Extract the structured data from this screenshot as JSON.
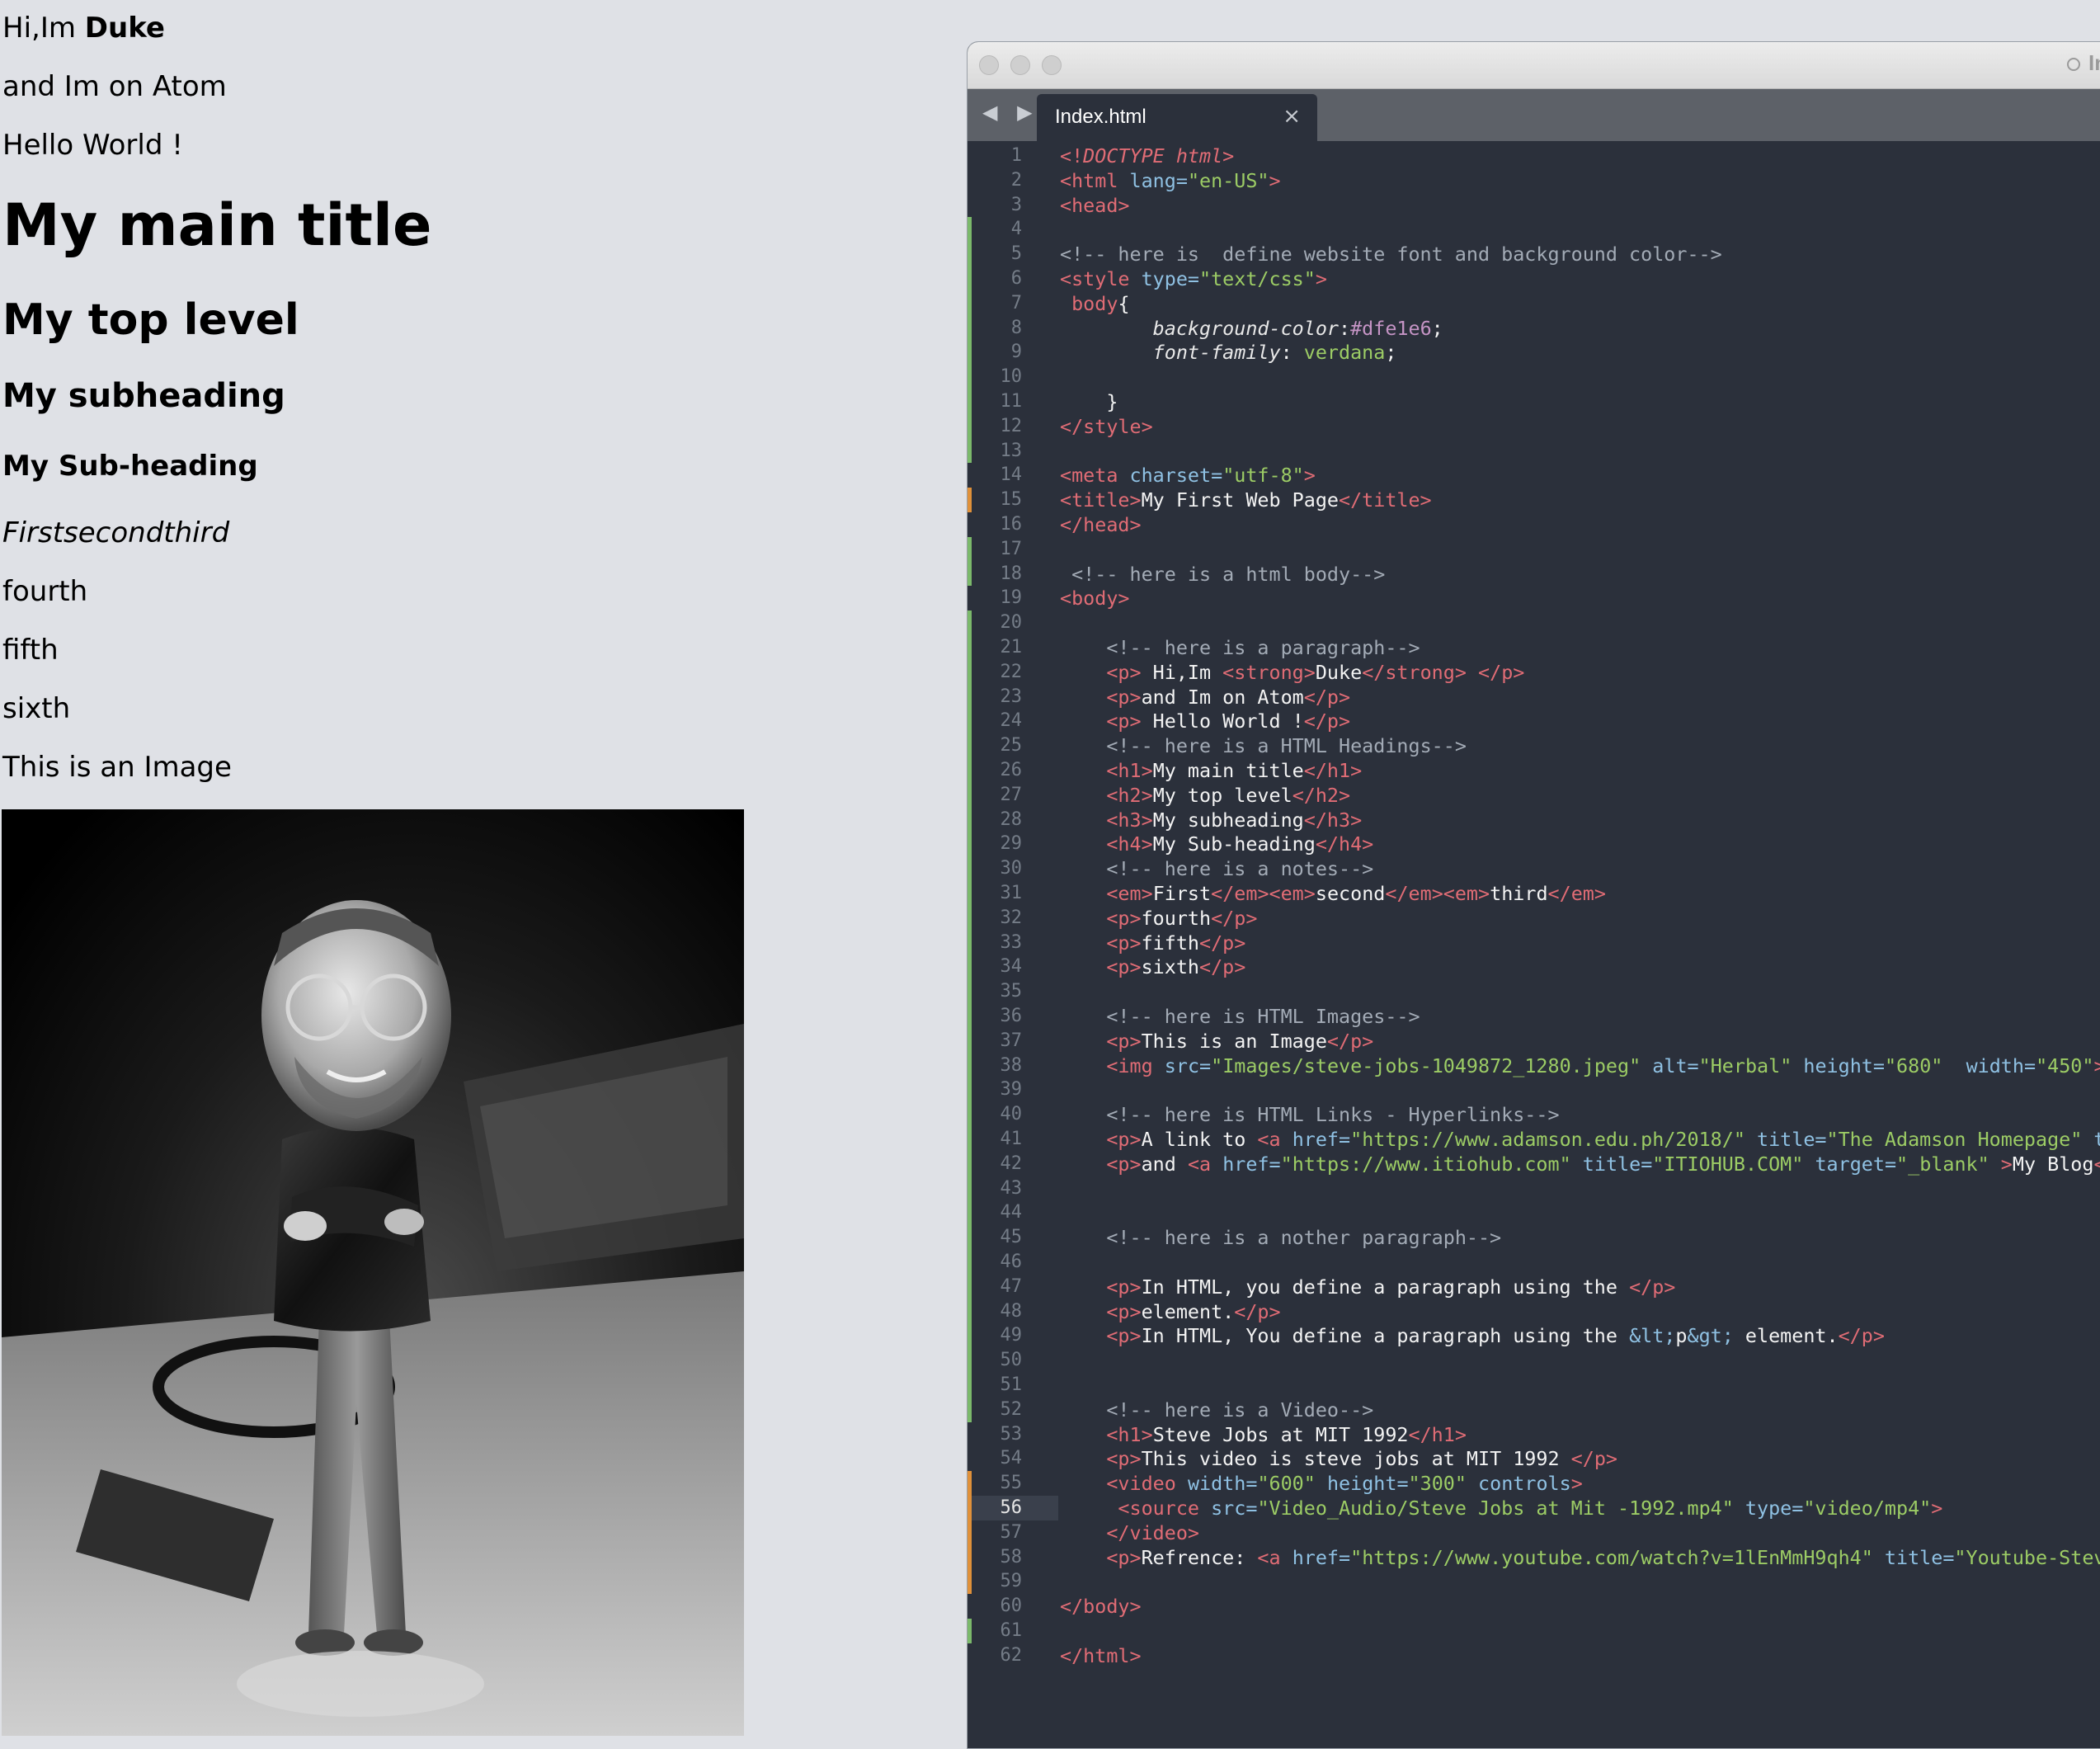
{
  "rendered_page": {
    "p1_text": "Hi,Im ",
    "p1_strong": "Duke",
    "p2": "and Im on Atom",
    "p3": "Hello World !",
    "h1": "My main title",
    "h2": "My top level",
    "h3": "My subheading",
    "h4": "My Sub-heading",
    "em_line": "Firstsecondthird",
    "p_fourth": "fourth",
    "p_fifth": "fifth",
    "p_sixth": "sixth",
    "p_image": "This is an Image"
  },
  "editor": {
    "window_title": "Ind",
    "tab_label": "Index.html",
    "tab_close": "×",
    "nav_arrows": "◀ ▶",
    "current_line": 56,
    "lines": [
      {
        "n": "1",
        "html": "<span class='tg'>&lt;!</span><span class='kw'>DOCTYPE html</span><span class='tg'>&gt;</span>"
      },
      {
        "n": "2",
        "html": "<span class='tg'>&lt;html</span> <span class='at'>lang=</span><span class='st'>\"en-US\"</span><span class='tg'>&gt;</span>"
      },
      {
        "n": "3",
        "html": "<span class='tg'>&lt;head&gt;</span>"
      },
      {
        "n": "4",
        "html": ""
      },
      {
        "n": "5",
        "html": "<span class='cm'>&lt;!-- here is  define website font and background color--&gt;</span>"
      },
      {
        "n": "6",
        "html": "<span class='tg'>&lt;style</span> <span class='at'>type=</span><span class='st'>\"text/css\"</span><span class='tg'>&gt;</span>"
      },
      {
        "n": "7",
        "html": " <span class='tg'>body</span><span class='tx'>{</span>"
      },
      {
        "n": "8",
        "html": "        <span class='pr'>background-color</span><span class='tx'>:</span><span class='hx'>#dfe1e6</span><span class='tx'>;</span>"
      },
      {
        "n": "9",
        "html": "        <span class='pr'>font-family</span><span class='tx'>: </span><span class='vl'>verdana</span><span class='tx'>;</span>"
      },
      {
        "n": "10",
        "html": ""
      },
      {
        "n": "11",
        "html": "    <span class='tx'>}</span>"
      },
      {
        "n": "12",
        "html": "<span class='tg'>&lt;/style&gt;</span>"
      },
      {
        "n": "13",
        "html": ""
      },
      {
        "n": "14",
        "html": "<span class='tg'>&lt;meta</span> <span class='at'>charset=</span><span class='st'>\"utf-8\"</span><span class='tg'>&gt;</span>"
      },
      {
        "n": "15",
        "html": "<span class='tg'>&lt;title&gt;</span><span class='tx'>My First Web Page</span><span class='tg'>&lt;/title&gt;</span>"
      },
      {
        "n": "16",
        "html": "<span class='tg'>&lt;/head&gt;</span>"
      },
      {
        "n": "17",
        "html": ""
      },
      {
        "n": "18",
        "html": " <span class='cm'>&lt;!-- here is a html body--&gt;</span>"
      },
      {
        "n": "19",
        "html": "<span class='tg'>&lt;body&gt;</span>"
      },
      {
        "n": "20",
        "html": ""
      },
      {
        "n": "21",
        "html": "    <span class='cm'>&lt;!-- here is a paragraph--&gt;</span>"
      },
      {
        "n": "22",
        "html": "    <span class='tg'>&lt;p&gt;</span><span class='tx'> Hi,Im </span><span class='tg'>&lt;strong&gt;</span><span class='tx'>Duke</span><span class='tg'>&lt;/strong&gt;</span><span class='tx'> </span><span class='tg'>&lt;/p&gt;</span>"
      },
      {
        "n": "23",
        "html": "    <span class='tg'>&lt;p&gt;</span><span class='tx'>and Im on Atom</span><span class='tg'>&lt;/p&gt;</span>"
      },
      {
        "n": "24",
        "html": "    <span class='tg'>&lt;p&gt;</span><span class='tx'> Hello World !</span><span class='tg'>&lt;/p&gt;</span>"
      },
      {
        "n": "25",
        "html": "    <span class='cm'>&lt;!-- here is a HTML Headings--&gt;</span>"
      },
      {
        "n": "26",
        "html": "    <span class='tg'>&lt;h1&gt;</span><span class='tx'>My main title</span><span class='tg'>&lt;/h1&gt;</span>"
      },
      {
        "n": "27",
        "html": "    <span class='tg'>&lt;h2&gt;</span><span class='tx'>My top level</span><span class='tg'>&lt;/h2&gt;</span>"
      },
      {
        "n": "28",
        "html": "    <span class='tg'>&lt;h3&gt;</span><span class='tx'>My subheading</span><span class='tg'>&lt;/h3&gt;</span>"
      },
      {
        "n": "29",
        "html": "    <span class='tg'>&lt;h4&gt;</span><span class='tx'>My Sub-heading</span><span class='tg'>&lt;/h4&gt;</span>"
      },
      {
        "n": "30",
        "html": "    <span class='cm'>&lt;!-- here is a notes--&gt;</span>"
      },
      {
        "n": "31",
        "html": "    <span class='tg'>&lt;em&gt;</span><span class='tx'>First</span><span class='tg'>&lt;/em&gt;&lt;em&gt;</span><span class='tx'>second</span><span class='tg'>&lt;/em&gt;&lt;em&gt;</span><span class='tx'>third</span><span class='tg'>&lt;/em&gt;</span>"
      },
      {
        "n": "32",
        "html": "    <span class='tg'>&lt;p&gt;</span><span class='tx'>fourth</span><span class='tg'>&lt;/p&gt;</span>"
      },
      {
        "n": "33",
        "html": "    <span class='tg'>&lt;p&gt;</span><span class='tx'>fifth</span><span class='tg'>&lt;/p&gt;</span>"
      },
      {
        "n": "34",
        "html": "    <span class='tg'>&lt;p&gt;</span><span class='tx'>sixth</span><span class='tg'>&lt;/p&gt;</span>"
      },
      {
        "n": "35",
        "html": ""
      },
      {
        "n": "36",
        "html": "    <span class='cm'>&lt;!-- here is HTML Images--&gt;</span>"
      },
      {
        "n": "37",
        "html": "    <span class='tg'>&lt;p&gt;</span><span class='tx'>This is an Image</span><span class='tg'>&lt;/p&gt;</span>"
      },
      {
        "n": "38",
        "html": "    <span class='tg'>&lt;img</span> <span class='at'>src=</span><span class='st'>\"Images/steve-jobs-1049872_1280.jpeg\"</span> <span class='at'>alt=</span><span class='st'>\"Herbal\"</span> <span class='at'>height=</span><span class='st'>\"680\"</span>  <span class='at'>width=</span><span class='st'>\"450\"</span><span class='tg'>&gt;</span>"
      },
      {
        "n": "39",
        "html": ""
      },
      {
        "n": "40",
        "html": "    <span class='cm'>&lt;!-- here is HTML Links - Hyperlinks--&gt;</span>"
      },
      {
        "n": "41",
        "html": "    <span class='tg'>&lt;p&gt;</span><span class='tx'>A link to </span><span class='tg'>&lt;a</span> <span class='at'>href=</span><span class='st'>\"https://www.adamson.edu.ph/2018/\"</span> <span class='at'>title=</span><span class='st'>\"The Adamson Homepage\"</span> <span class='at'>t</span>"
      },
      {
        "n": "42",
        "html": "    <span class='tg'>&lt;p&gt;</span><span class='tx'>and </span><span class='tg'>&lt;a</span> <span class='at'>href=</span><span class='st'>\"https://www.itiohub.com\"</span> <span class='at'>title=</span><span class='st'>\"ITIOHUB.COM\"</span> <span class='at'>target=</span><span class='st'>\"_blank\"</span> <span class='tg'>&gt;</span><span class='tx'>My Blog</span><span class='tg'>&lt;</span>"
      },
      {
        "n": "43",
        "html": ""
      },
      {
        "n": "44",
        "html": ""
      },
      {
        "n": "45",
        "html": "    <span class='cm'>&lt;!-- here is a nother paragraph--&gt;</span>"
      },
      {
        "n": "46",
        "html": ""
      },
      {
        "n": "47",
        "html": "    <span class='tg'>&lt;p&gt;</span><span class='tx'>In HTML, you define a paragraph using the </span><span class='tg'>&lt;/p&gt;</span>"
      },
      {
        "n": "48",
        "html": "    <span class='tg'>&lt;p&gt;</span><span class='tx'>element.</span><span class='tg'>&lt;/p&gt;</span>"
      },
      {
        "n": "49",
        "html": "    <span class='tg'>&lt;p&gt;</span><span class='tx'>In HTML, You define a paragraph using the </span><span class='at'>&amp;lt;</span><span class='tx'>p</span><span class='at'>&amp;gt;</span><span class='tx'> element.</span><span class='tg'>&lt;/p&gt;</span>"
      },
      {
        "n": "50",
        "html": ""
      },
      {
        "n": "51",
        "html": ""
      },
      {
        "n": "52",
        "html": "    <span class='cm'>&lt;!-- here is a Video--&gt;</span>"
      },
      {
        "n": "53",
        "html": "    <span class='tg'>&lt;h1&gt;</span><span class='tx'>Steve Jobs at MIT 1992</span><span class='tg'>&lt;/h1&gt;</span>"
      },
      {
        "n": "54",
        "html": "    <span class='tg'>&lt;p&gt;</span><span class='tx'>This video is steve jobs at MIT 1992 </span><span class='tg'>&lt;/p&gt;</span>"
      },
      {
        "n": "55",
        "html": "    <span class='tg'>&lt;video</span> <span class='at'>width=</span><span class='st'>\"600\"</span> <span class='at'>height=</span><span class='st'>\"300\"</span> <span class='at'>controls</span><span class='tg'>&gt;</span>"
      },
      {
        "n": "56",
        "html": "     <span class='tg'>&lt;source</span> <span class='at'>src=</span><span class='st'>\"Video_Audio/Steve Jobs at Mit -1992.mp4\"</span> <span class='at'>type=</span><span class='st'>\"video/mp4\"</span><span class='tg'>&gt;</span>"
      },
      {
        "n": "57",
        "html": "    <span class='tg'>&lt;/video&gt;</span>"
      },
      {
        "n": "58",
        "html": "    <span class='tg'>&lt;p&gt;</span><span class='tx'>Refrence: </span><span class='tg'>&lt;a</span> <span class='at'>href=</span><span class='st'>\"https://www.youtube.com/watch?v=1lEnMmH9qh4\"</span> <span class='at'>title=</span><span class='st'>\"Youtube-Stev</span>"
      },
      {
        "n": "59",
        "html": ""
      },
      {
        "n": "60",
        "html": "<span class='tg'>&lt;/body&gt;</span>"
      },
      {
        "n": "61",
        "html": ""
      },
      {
        "n": "62",
        "html": "<span class='tg'>&lt;/html&gt;</span>"
      }
    ],
    "git_markers": [
      {
        "from": 4,
        "to": 13,
        "color": "#7bb96b"
      },
      {
        "from": 15,
        "to": 15,
        "color": "#e0913a"
      },
      {
        "from": 17,
        "to": 18,
        "color": "#7bb96b"
      },
      {
        "from": 20,
        "to": 52,
        "color": "#7bb96b"
      },
      {
        "from": 55,
        "to": 59,
        "color": "#e0913a"
      },
      {
        "from": 61,
        "to": 61,
        "color": "#7bb96b"
      }
    ],
    "colors": {
      "editor_bg": "#2b303b",
      "tab_bar": "#5d6168",
      "page_bg": "#dfe1e6"
    }
  }
}
